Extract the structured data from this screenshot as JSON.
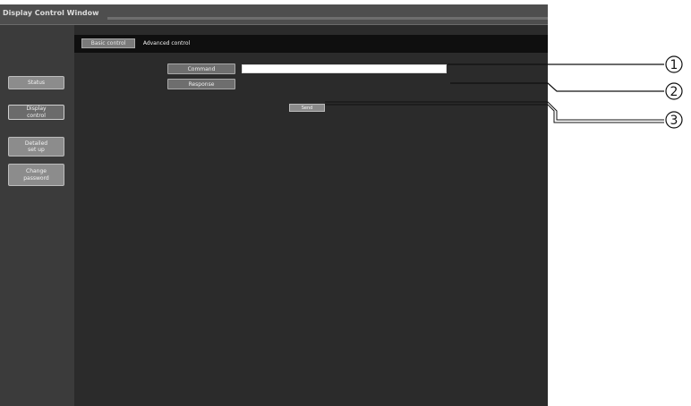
{
  "window": {
    "title": "Display Control Window"
  },
  "sidebar": {
    "items": [
      {
        "label": "Status",
        "active": false
      },
      {
        "label": "Display\ncontrol",
        "active": true
      },
      {
        "label": "Detailed\nset up",
        "active": false
      },
      {
        "label": "Change\npassword",
        "active": false
      }
    ]
  },
  "tabs": {
    "basic_label": "Basic control",
    "advanced_label": "Advanced control"
  },
  "form": {
    "command_label": "Command",
    "command_value": "",
    "response_label": "Response",
    "response_value": "",
    "send_label": "Send"
  },
  "callouts": [
    {
      "number": "1",
      "symbol": "①"
    },
    {
      "number": "2",
      "symbol": "②"
    },
    {
      "number": "3",
      "symbol": "③"
    }
  ],
  "colors": {
    "window_bg": "#2c2c2c",
    "titlebar_bg": "#4e4e4e",
    "sidebar_bg": "#3b3b3b",
    "tabbar_bg": "#0f0f0f",
    "button_bg": "#8c8c8c",
    "input_bg": "#ffffff"
  }
}
